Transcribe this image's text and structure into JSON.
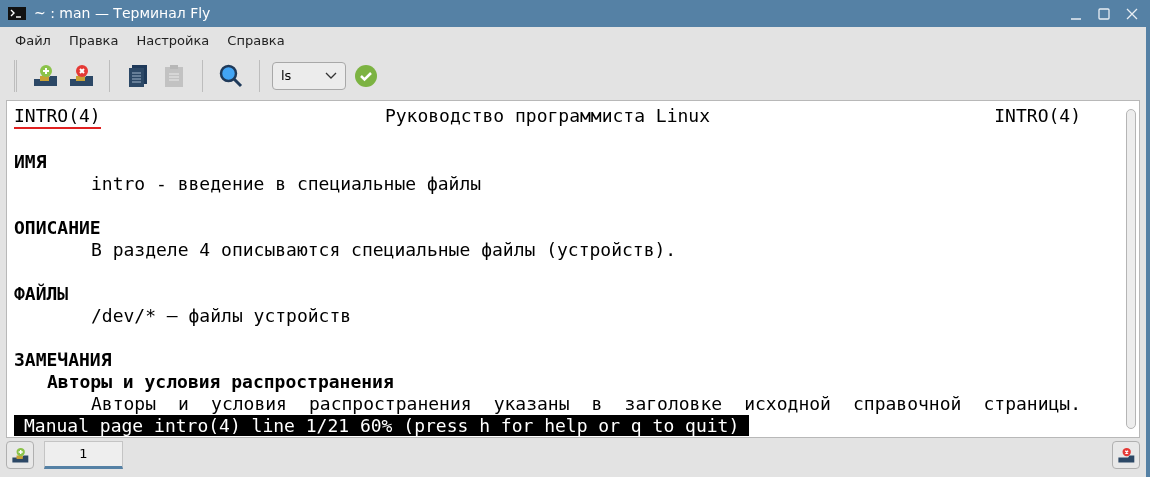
{
  "window": {
    "title": "~ : man — Терминал Fly"
  },
  "menu": [
    "Файл",
    "Правка",
    "Настройка",
    "Справка"
  ],
  "toolbar": [
    {
      "kind": "new-tab",
      "disabled": false
    },
    {
      "kind": "close-tab",
      "disabled": false
    },
    {
      "kind": "separator"
    },
    {
      "kind": "copy",
      "disabled": false
    },
    {
      "kind": "paste",
      "disabled": true
    },
    {
      "kind": "separator"
    },
    {
      "kind": "search",
      "disabled": false
    },
    {
      "kind": "separator"
    },
    {
      "kind": "command",
      "value": "ls"
    },
    {
      "kind": "run",
      "disabled": false
    }
  ],
  "terminal": {
    "header": {
      "left": "INTRO(4)",
      "left_underlined": true,
      "center": "Руководство программиста Linux",
      "right": "INTRO(4)"
    },
    "sections": [
      {
        "heading": "ИМЯ",
        "lines": [
          {
            "kind": "text",
            "text": "intro - введение в специальные файлы"
          }
        ]
      },
      {
        "heading": "ОПИСАНИЕ",
        "lines": [
          {
            "kind": "text",
            "text": "В разделе 4 описываются специальные файлы (устройств)."
          }
        ]
      },
      {
        "heading": "ФАЙЛЫ",
        "lines": [
          {
            "kind": "text",
            "text": "/dev/* — файлы устройств"
          }
        ]
      },
      {
        "heading": "ЗАМЕЧАНИЯ",
        "lines": [
          {
            "kind": "subheading",
            "text": "Авторы и условия распространения"
          },
          {
            "kind": "justified",
            "text": "Авторы и условия распространения указаны в заголовке исходной справочной страницы."
          }
        ]
      }
    ],
    "status_line": "Manual page intro(4) line 1/21 60% (press h for help or q to quit)"
  },
  "tabs": [
    {
      "label": "1",
      "selected": true
    }
  ]
}
